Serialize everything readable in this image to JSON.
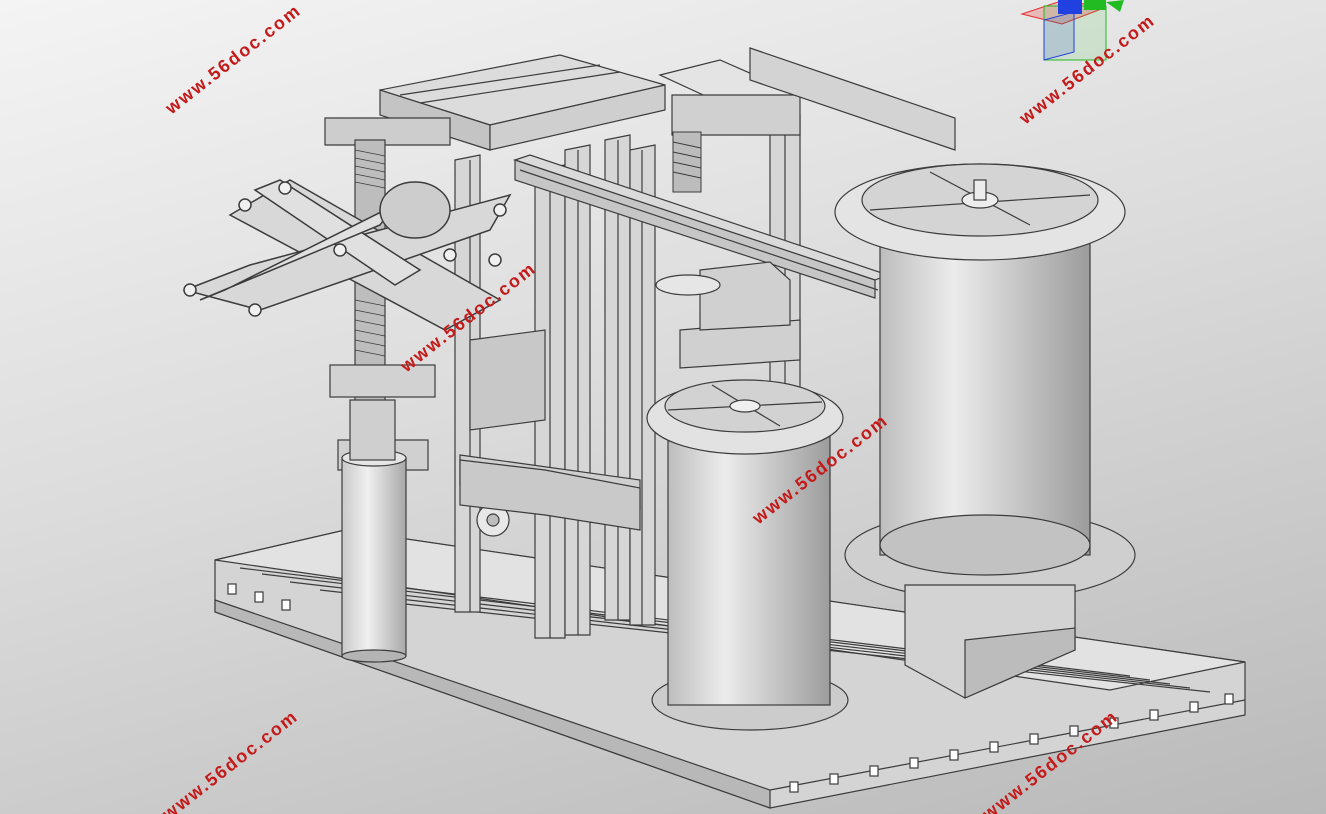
{
  "viewport": {
    "background_top": "#f4f4f4",
    "background_bottom": "#b9b9b9"
  },
  "watermarks": [
    {
      "text": "www.56doc.com"
    },
    {
      "text": "www.56doc.com"
    },
    {
      "text": "www.56doc.com"
    },
    {
      "text": "www.56doc.com"
    },
    {
      "text": "www.56doc.com"
    },
    {
      "text": "www.56doc.com"
    }
  ],
  "watermark_color": "#c41a1a",
  "triad": {
    "x_axis_color": "#e83030",
    "y_axis_color": "#22bb22",
    "z_axis_color": "#2040e0",
    "icon": "view-orientation-triad-icon"
  },
  "model": {
    "icon": "cad-assembly-icon",
    "part_fill": "#d8d8d8",
    "edge_color": "#3c3c3c"
  }
}
